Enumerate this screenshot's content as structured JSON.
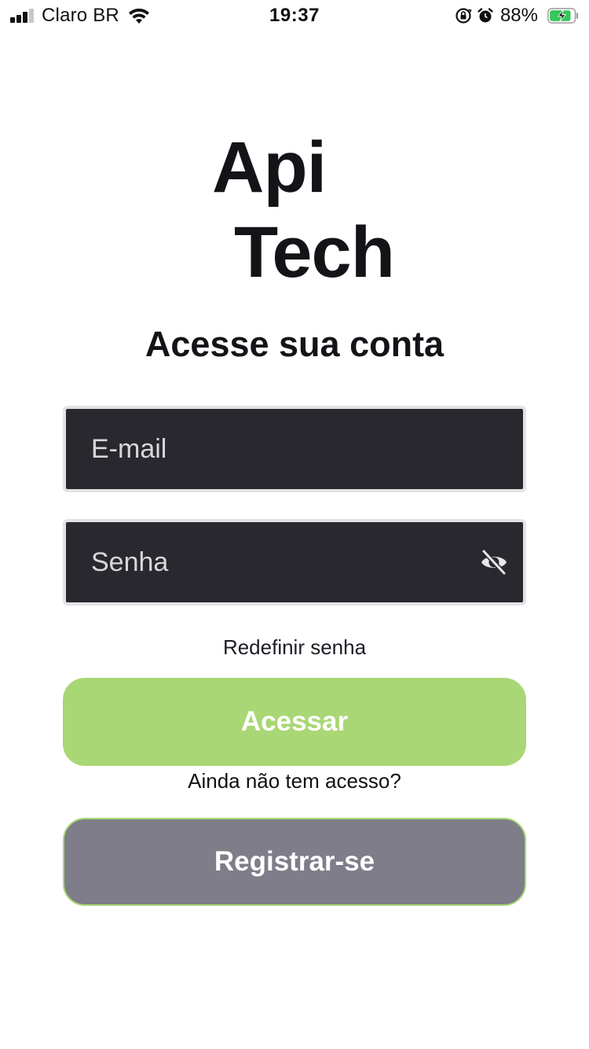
{
  "status_bar": {
    "carrier": "Claro BR",
    "time": "19:37",
    "battery_percent": "88%",
    "signal_icon": "cellular-signal-icon",
    "wifi_icon": "wifi-icon",
    "orientation_lock_icon": "orientation-lock-icon",
    "alarm_icon": "alarm-icon",
    "battery_icon": "battery-charging-icon",
    "battery_level": 0.88,
    "battery_color": "#34c759"
  },
  "logo": {
    "line1": "Api",
    "line2": "Tech"
  },
  "title": "Acesse sua conta",
  "form": {
    "email_placeholder": "E-mail",
    "password_placeholder": "Senha",
    "password_toggle_icon": "eye-off-icon"
  },
  "links": {
    "reset_password": "Redefinir senha",
    "no_access_text": "Ainda não tem acesso?"
  },
  "buttons": {
    "login": "Acessar",
    "register": "Registrar-se"
  },
  "colors": {
    "primary_green": "#a9d775",
    "secondary_gray": "#7e7d89",
    "input_background": "#29282e",
    "text_dark": "#141418"
  }
}
